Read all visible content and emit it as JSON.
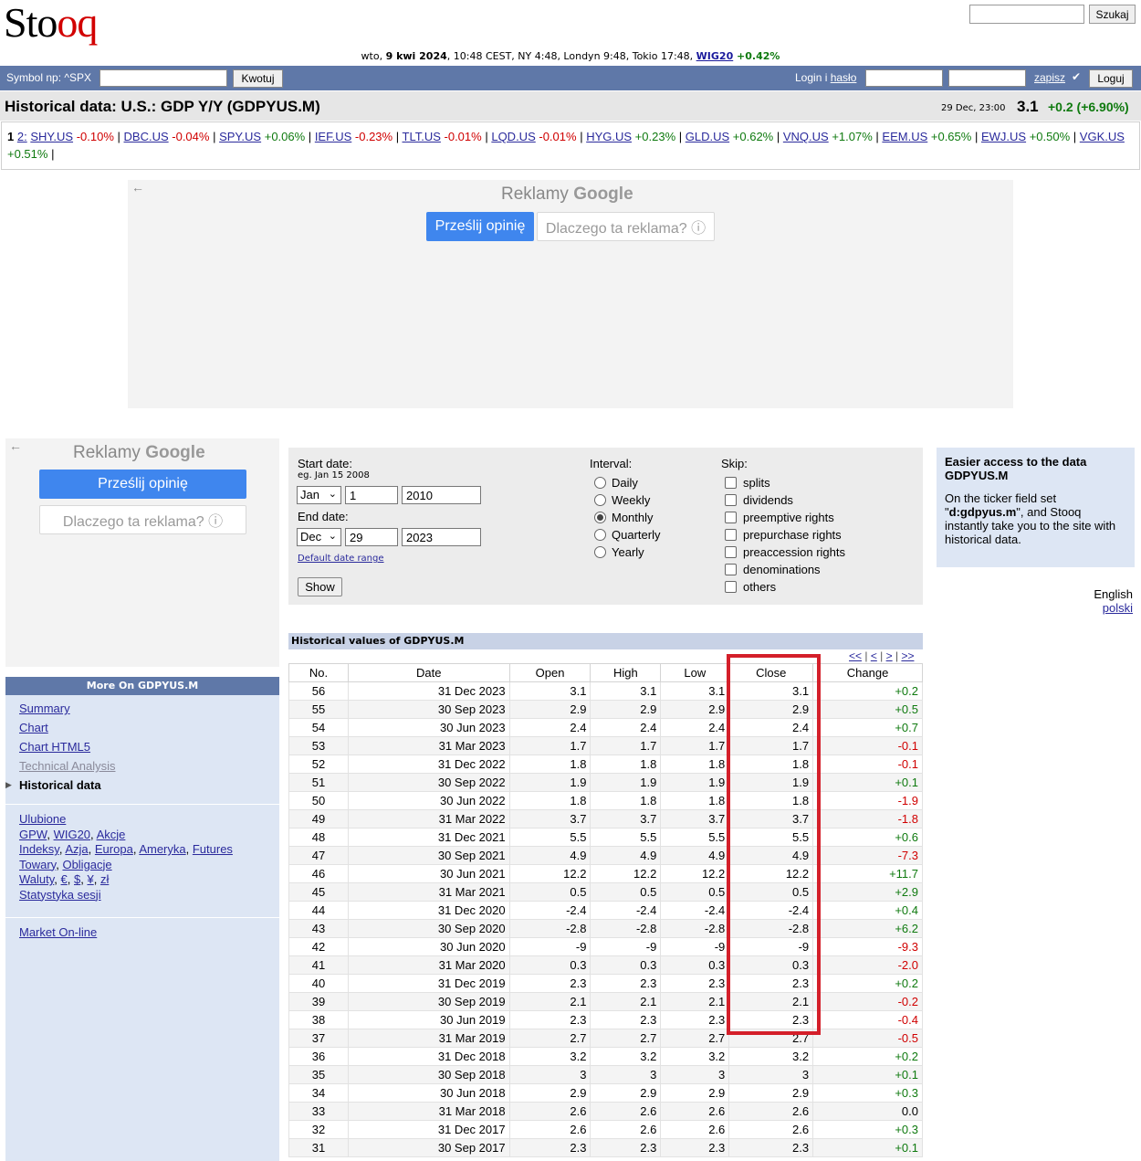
{
  "brand": {
    "logo": "Stooq",
    "logo_plain": "Sto",
    "logo_colored": "oq"
  },
  "search": {
    "button": "Szukaj"
  },
  "timeline": {
    "prefix": "wto, ",
    "date_bold": "9 kwi 2024",
    "rest": ", 10:48 CEST, NY 4:48, Londyn 9:48, Tokio 17:48, ",
    "index_link": "WIG20",
    "index_change": " +0.42%"
  },
  "topbar": {
    "symbol_label": "Symbol np: ^SPX",
    "quote_button": "Kwotuj",
    "login_label": "Login i ",
    "password_link": "hasło",
    "remember_link": "zapisz",
    "remember_check": "✔",
    "login_button": "Loguj"
  },
  "title": {
    "text": "Historical data: U.S.: GDP Y/Y (GDPYUS.M)",
    "quote_date": "29 Dec, 23:00",
    "quote_value": "3.1",
    "quote_change": "+0.2 (+6.90%)"
  },
  "tickers": {
    "page_current": "1",
    "page_other": "2:",
    "items": [
      {
        "sym": "SHY.US",
        "chg": "-0.10%",
        "dir": "neg"
      },
      {
        "sym": "DBC.US",
        "chg": "-0.04%",
        "dir": "neg"
      },
      {
        "sym": "SPY.US",
        "chg": "+0.06%",
        "dir": "pos"
      },
      {
        "sym": "IEF.US",
        "chg": "-0.23%",
        "dir": "neg"
      },
      {
        "sym": "TLT.US",
        "chg": "-0.01%",
        "dir": "neg"
      },
      {
        "sym": "LQD.US",
        "chg": "-0.01%",
        "dir": "neg"
      },
      {
        "sym": "HYG.US",
        "chg": "+0.23%",
        "dir": "pos"
      },
      {
        "sym": "GLD.US",
        "chg": "+0.62%",
        "dir": "pos"
      },
      {
        "sym": "VNQ.US",
        "chg": "+1.07%",
        "dir": "pos"
      },
      {
        "sym": "EEM.US",
        "chg": "+0.65%",
        "dir": "pos"
      },
      {
        "sym": "EWJ.US",
        "chg": "+0.50%",
        "dir": "pos"
      },
      {
        "sym": "VGK.US",
        "chg": "+0.51%",
        "dir": "pos"
      }
    ]
  },
  "ads": {
    "brand_text": "Reklamy ",
    "brand_google": "Google",
    "feedback_button": "Prześlij opinię",
    "why_button": "Dlaczego ta reklama? ⓘ",
    "back_arrow": "←"
  },
  "left_panel": {
    "header": "More On GDPYUS.M",
    "nav": [
      {
        "label": "Summary",
        "state": "link"
      },
      {
        "label": "Chart",
        "state": "link"
      },
      {
        "label": "Chart HTML5",
        "state": "link"
      },
      {
        "label": "Technical Analysis",
        "state": "dim"
      },
      {
        "label": "Historical data",
        "state": "current"
      }
    ],
    "current_marker": "▶",
    "ulubione": "Ulubione",
    "line1": [
      "GPW",
      "WIG20",
      "Akcje"
    ],
    "line2": [
      "Indeksy",
      "Azja",
      "Europa",
      "Ameryka",
      "Futures"
    ],
    "line3": [
      "Towary",
      "Obligacje"
    ],
    "line4": [
      "Waluty",
      "€",
      "$",
      "¥",
      "zł"
    ],
    "line5": "Statystyka sesji",
    "market": "Market On-line"
  },
  "form": {
    "start_label": "Start date:",
    "example": "eg. Jan 15 2008",
    "start_month": "Jan",
    "start_day": "1",
    "start_year": "2010",
    "end_label": "End date:",
    "end_month": "Dec",
    "end_day": "29",
    "end_year": "2023",
    "default_range": "Default date range",
    "show_button": "Show",
    "interval_label": "Interval:",
    "intervals": [
      "Daily",
      "Weekly",
      "Monthly",
      "Quarterly",
      "Yearly"
    ],
    "interval_selected": "Monthly",
    "skip_label": "Skip:",
    "skips": [
      "splits",
      "dividends",
      "preemptive rights",
      "prepurchase rights",
      "preaccession rights",
      "denominations",
      "others"
    ]
  },
  "info_box": {
    "heading": "Easier access to the data GDPYUS.M",
    "body_pre": "On the ticker field set \"",
    "body_code": "d:gdpyus.m",
    "body_post": "\", and Stooq instantly take you to the site with historical data."
  },
  "language": {
    "english": "English",
    "polski": "polski"
  },
  "history": {
    "header": "Historical values of GDPYUS.M",
    "pager": [
      "<<",
      "<",
      ">",
      ">>"
    ],
    "columns": [
      "No.",
      "Date",
      "Open",
      "High",
      "Low",
      "Close",
      "Change"
    ],
    "rows": [
      [
        "56",
        "31 Dec 2023",
        "3.1",
        "3.1",
        "3.1",
        "3.1",
        "+0.2"
      ],
      [
        "55",
        "30 Sep 2023",
        "2.9",
        "2.9",
        "2.9",
        "2.9",
        "+0.5"
      ],
      [
        "54",
        "30 Jun 2023",
        "2.4",
        "2.4",
        "2.4",
        "2.4",
        "+0.7"
      ],
      [
        "53",
        "31 Mar 2023",
        "1.7",
        "1.7",
        "1.7",
        "1.7",
        "-0.1"
      ],
      [
        "52",
        "31 Dec 2022",
        "1.8",
        "1.8",
        "1.8",
        "1.8",
        "-0.1"
      ],
      [
        "51",
        "30 Sep 2022",
        "1.9",
        "1.9",
        "1.9",
        "1.9",
        "+0.1"
      ],
      [
        "50",
        "30 Jun 2022",
        "1.8",
        "1.8",
        "1.8",
        "1.8",
        "-1.9"
      ],
      [
        "49",
        "31 Mar 2022",
        "3.7",
        "3.7",
        "3.7",
        "3.7",
        "-1.8"
      ],
      [
        "48",
        "31 Dec 2021",
        "5.5",
        "5.5",
        "5.5",
        "5.5",
        "+0.6"
      ],
      [
        "47",
        "30 Sep 2021",
        "4.9",
        "4.9",
        "4.9",
        "4.9",
        "-7.3"
      ],
      [
        "46",
        "30 Jun 2021",
        "12.2",
        "12.2",
        "12.2",
        "12.2",
        "+11.7"
      ],
      [
        "45",
        "31 Mar 2021",
        "0.5",
        "0.5",
        "0.5",
        "0.5",
        "+2.9"
      ],
      [
        "44",
        "31 Dec 2020",
        "-2.4",
        "-2.4",
        "-2.4",
        "-2.4",
        "+0.4"
      ],
      [
        "43",
        "30 Sep 2020",
        "-2.8",
        "-2.8",
        "-2.8",
        "-2.8",
        "+6.2"
      ],
      [
        "42",
        "30 Jun 2020",
        "-9",
        "-9",
        "-9",
        "-9",
        "-9.3"
      ],
      [
        "41",
        "31 Mar 2020",
        "0.3",
        "0.3",
        "0.3",
        "0.3",
        "-2.0"
      ],
      [
        "40",
        "31 Dec 2019",
        "2.3",
        "2.3",
        "2.3",
        "2.3",
        "+0.2"
      ],
      [
        "39",
        "30 Sep 2019",
        "2.1",
        "2.1",
        "2.1",
        "2.1",
        "-0.2"
      ],
      [
        "38",
        "30 Jun 2019",
        "2.3",
        "2.3",
        "2.3",
        "2.3",
        "-0.4"
      ],
      [
        "37",
        "31 Mar 2019",
        "2.7",
        "2.7",
        "2.7",
        "2.7",
        "-0.5"
      ],
      [
        "36",
        "31 Dec 2018",
        "3.2",
        "3.2",
        "3.2",
        "3.2",
        "+0.2"
      ],
      [
        "35",
        "30 Sep 2018",
        "3",
        "3",
        "3",
        "3",
        "+0.1"
      ],
      [
        "34",
        "30 Jun 2018",
        "2.9",
        "2.9",
        "2.9",
        "2.9",
        "+0.3"
      ],
      [
        "33",
        "31 Mar 2018",
        "2.6",
        "2.6",
        "2.6",
        "2.6",
        "0.0"
      ],
      [
        "32",
        "31 Dec 2017",
        "2.6",
        "2.6",
        "2.6",
        "2.6",
        "+0.3"
      ],
      [
        "31",
        "30 Sep 2017",
        "2.3",
        "2.3",
        "2.3",
        "2.3",
        "+0.1"
      ]
    ]
  },
  "colors": {
    "highlight": "#d41f2a",
    "positive": "#0f7a0f",
    "negative": "#d00000",
    "nav_blue": "#5f78a8"
  }
}
